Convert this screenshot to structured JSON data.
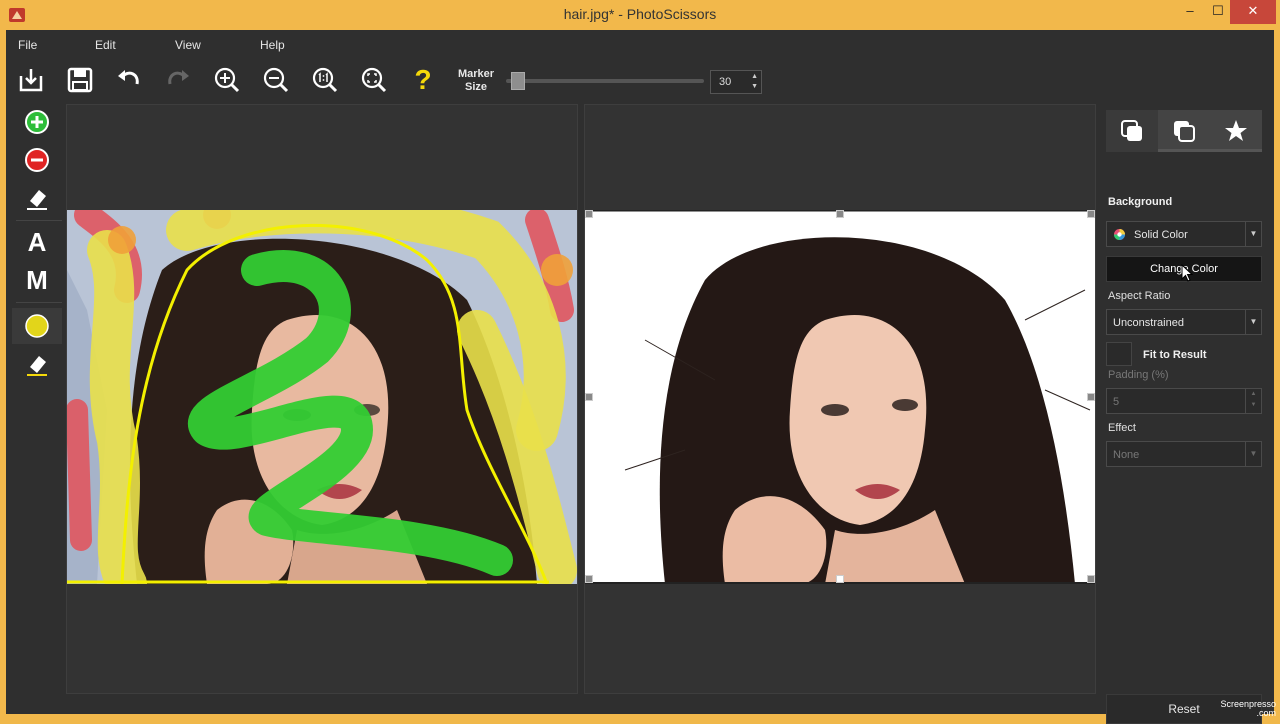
{
  "window": {
    "title": "hair.jpg* - PhotoScissors",
    "minimize": "–",
    "maximize": "☐",
    "close": "✕"
  },
  "menu": [
    "File",
    "Edit",
    "View",
    "Help"
  ],
  "toolbar": {
    "marker_label": "Marker",
    "marker_label_2": "Size",
    "marker_size": "30",
    "marker_level": 0.06,
    "help_glyph": "?"
  },
  "tools": {
    "text_tool": "A",
    "mask_tool": "M"
  },
  "side": {
    "background_label": "Background",
    "background_mode": "Solid Color",
    "change_color": "Change Color",
    "aspect_label": "Aspect Ratio",
    "aspect_value": "Unconstrained",
    "fit_label": "Fit to Result",
    "padding_label": "Padding (%)",
    "padding_value": "5",
    "effect_label": "Effect",
    "effect_value": "None",
    "reset": "Reset"
  },
  "watermark": {
    "line1": "Screenpresso",
    "line2": ".com"
  },
  "colors": {
    "title_bar": "#f2b84b",
    "frame": "#2f2f2f",
    "keep_marker": "#33cc33",
    "remove_marker": "#e8e23a"
  }
}
